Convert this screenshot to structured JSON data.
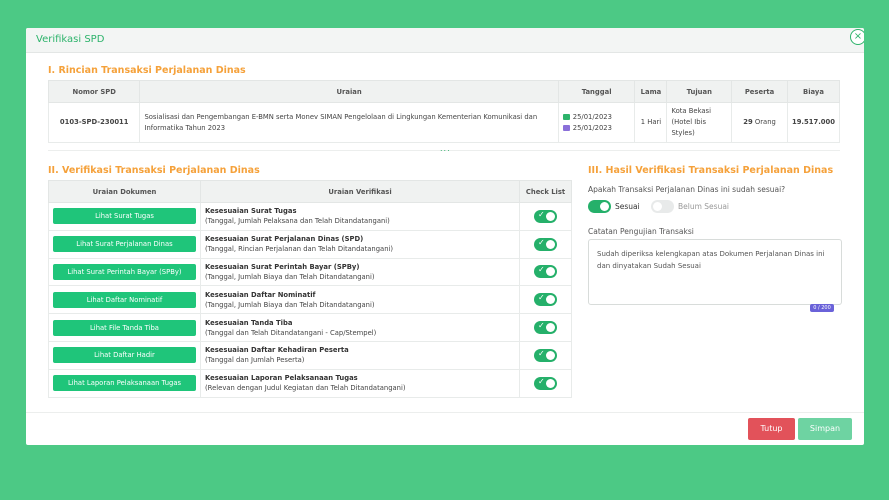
{
  "modal": {
    "title": "Verifikasi SPD",
    "close_icon": "close-circle-icon"
  },
  "section1": {
    "heading": "I. Rincian Transaksi Perjalanan Dinas",
    "headers": [
      "Nomor SPD",
      "Uraian",
      "Tanggal",
      "Lama",
      "Tujuan",
      "Peserta",
      "Biaya"
    ],
    "row": {
      "nomor": "0103-SPD-230011",
      "uraian": "Sosialisasi dan Pengembangan E-BMN serta Monev SIMAN Pengelolaan di Lingkungan Kementerian Komunikasi dan Informatika Tahun 2023",
      "tanggal_mulai": "25/01/2023",
      "tanggal_selesai": "25/01/2023",
      "lama": "1 Hari",
      "tujuan": "Kota Bekasi (Hotel Ibis Styles)",
      "peserta_jumlah": "29",
      "peserta_unit": "Orang",
      "biaya": "19.517.000"
    },
    "expand_dots": "..."
  },
  "section2": {
    "heading": "II. Verifikasi Transaksi Perjalanan Dinas",
    "headers": [
      "Uraian Dokumen",
      "Uraian Verifikasi",
      "Check List"
    ],
    "rows": [
      {
        "button": "Lihat Surat Tugas",
        "title": "Kesesuaian Surat Tugas",
        "detail": "(Tanggal, Jumlah Pelaksana dan Telah Ditandatangani)",
        "checked": true
      },
      {
        "button": "Lihat Surat Perjalanan Dinas",
        "title": "Kesesuaian Surat Perjalanan Dinas (SPD)",
        "detail": "(Tanggal, Rincian Perjalanan dan Telah Ditandatangani)",
        "checked": true
      },
      {
        "button": "Lihat Surat Perintah Bayar (SPBy)",
        "title": "Kesesuaian Surat Perintah Bayar (SPBy)",
        "detail": "(Tanggal, Jumlah Biaya dan Telah Ditandatangani)",
        "checked": true
      },
      {
        "button": "Lihat Daftar Nominatif",
        "title": "Kesesuaian Daftar Nominatif",
        "detail": "(Tanggal, Jumlah Biaya dan Telah Ditandatangani)",
        "checked": true
      },
      {
        "button": "Lihat File Tanda Tiba",
        "title": "Kesesuaian Tanda Tiba",
        "detail": "(Tanggal dan Telah Ditandatangani - Cap/Stempel)",
        "checked": true
      },
      {
        "button": "Lihat Daftar Hadir",
        "title": "Kesesuaian Daftar Kehadiran Peserta",
        "detail": "(Tanggal dan Jumlah Peserta)",
        "checked": true
      },
      {
        "button": "Lihat Laporan Pelaksanaan Tugas",
        "title": "Kesesuaian Laporan Pelaksanaan Tugas",
        "detail": "(Relevan dengan Judul Kegiatan dan Telah Ditandatangani)",
        "checked": true
      }
    ]
  },
  "section3": {
    "heading": "III. Hasil Verifikasi Transaksi Perjalanan Dinas",
    "question": "Apakah Transaksi Perjalanan Dinas ini sudah sesuai?",
    "option_yes": "Sesuai",
    "option_no": "Belum Sesuai",
    "selected": "Sesuai",
    "notes_label": "Catatan Pengujian Transaksi",
    "notes_value": "Sudah diperiksa kelengkapan atas Dokumen Perjalanan Dinas ini dan dinyatakan Sudah Sesuai",
    "counter": "0 / 200"
  },
  "footer": {
    "cancel": "Tutup",
    "save": "Simpan"
  },
  "colors": {
    "accent": "#2db36b",
    "heading": "#f5a13a",
    "button": "#1fc57a",
    "danger": "#e2525a",
    "save": "#6ed3a2"
  }
}
